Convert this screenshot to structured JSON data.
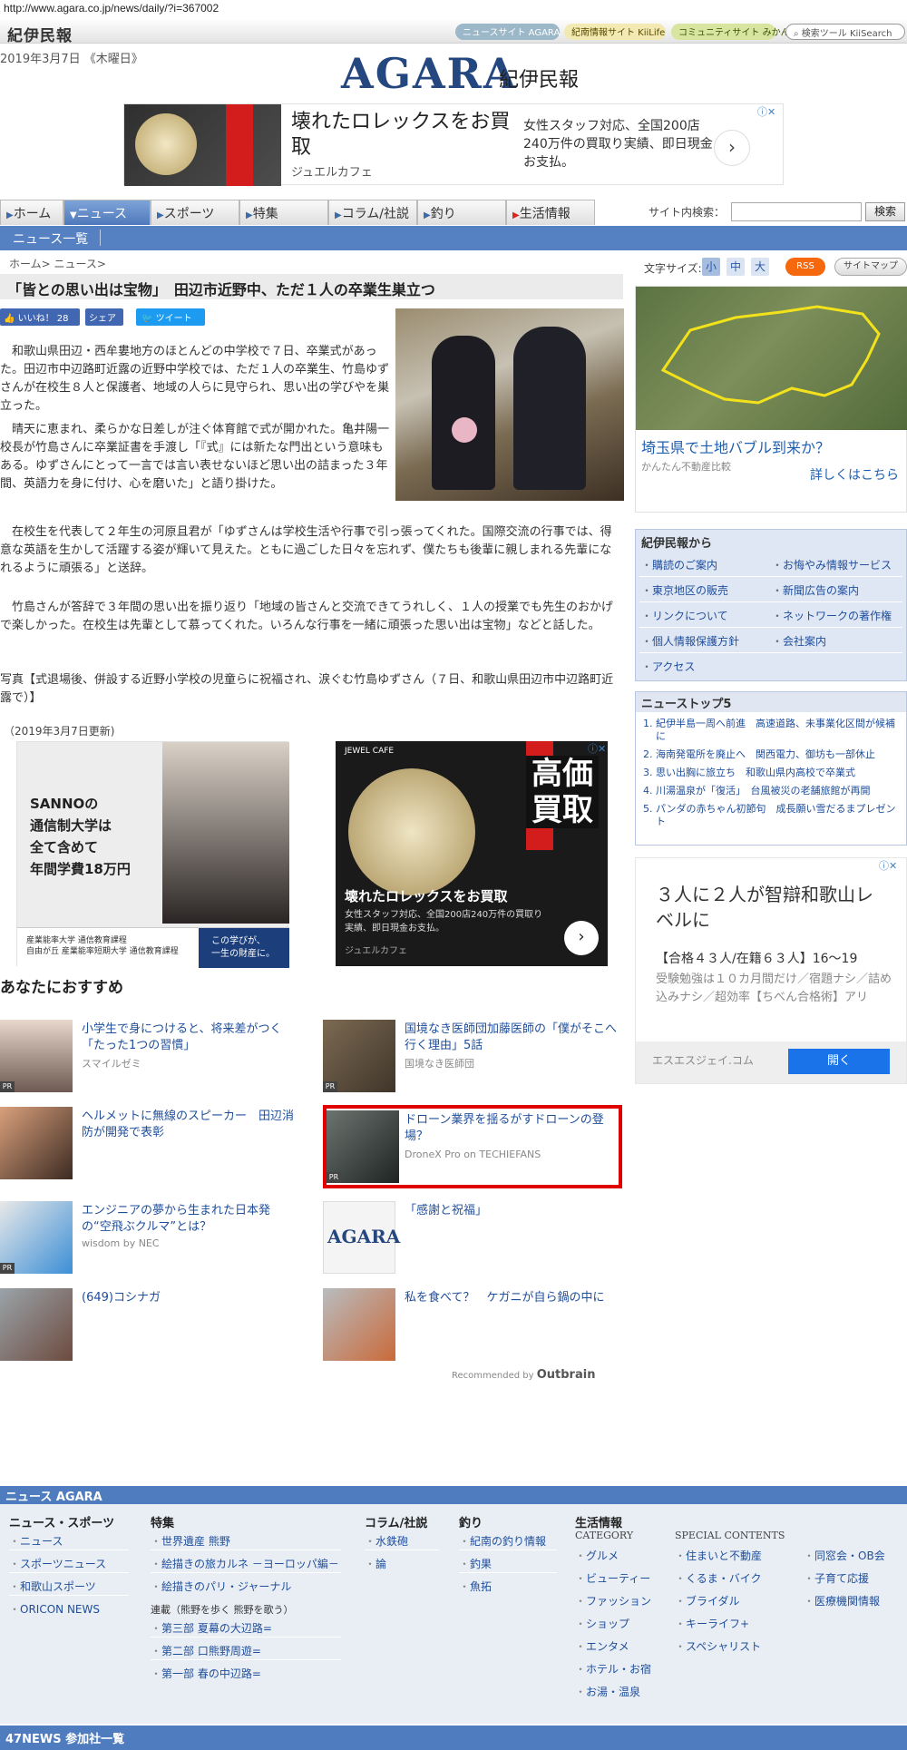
{
  "url": "http://www.agara.co.jp/news/daily/?i=367002",
  "site": {
    "small_logo": "紀伊民報",
    "top_links": [
      "ニュースサイト AGARA",
      "紀南情報サイト KiiLife",
      "コミュニティサイト みかん",
      "検索ツール KiiSearch"
    ],
    "date": "2019年3月7日 《木曜日》",
    "logo": "AGARA",
    "logo_sub": "紀伊民報"
  },
  "top_ad": {
    "headline": "壊れたロレックスをお買取",
    "advertiser": "ジュエルカフェ",
    "desc": "女性スタッフ対応、全国200店240万件の買取り実績、即日現金お支払。",
    "arrow": "›",
    "badge": "ⓘ✕"
  },
  "nav": {
    "tabs": [
      "ホーム",
      "ニュース",
      "スポーツ",
      "特集",
      "コラム/社説",
      "釣り",
      "生活情報"
    ],
    "search_label": "サイト内検索：",
    "search_button": "検索",
    "subnav": "ニュース一覧"
  },
  "article": {
    "breadcrumb": "ホーム> ニュース>",
    "title": "「皆との思い出は宝物」　田辺市近野中、ただ１人の卒業生巣立つ",
    "like": "👍 いいね！ 28",
    "share": "シェア",
    "tweet": "🐦 ツイート",
    "p1": "　和歌山県田辺・西牟婁地方のほとんどの中学校で７日、卒業式があった。田辺市中辺路町近露の近野中学校では、ただ１人の卒業生、竹島ゆずさんが在校生８人と保護者、地域の人らに見守られ、思い出の学びやを巣立った。",
    "p2": "　晴天に恵まれ、柔らかな日差しが注ぐ体育館で式が開かれた。亀井陽一校長が竹島さんに卒業証書を手渡し「『式』には新たな門出という意味もある。ゆずさんにとって一言では言い表せないほど思い出の詰まった３年間、英語力を身に付け、心を磨いた」と語り掛けた。",
    "p3": "　在校生を代表して２年生の河原且君が「ゆずさんは学校生活や行事で引っ張ってくれた。国際交流の行事では、得意な英語を生かして活躍する姿が輝いて見えた。ともに過ごした日々を忘れず、僕たちも後輩に親しまれる先輩になれるように頑張る」と送辞。",
    "p4": "　竹島さんが答辞で３年間の思い出を振り返り「地域の皆さんと交流できてうれしく、１人の授業でも先生のおかげで楽しかった。在校生は先輩として慕ってくれた。いろんな行事を一緒に頑張った思い出は宝物」などと話した。",
    "caption": "写真【式退場後、併設する近野小学校の児童らに祝福され、涙ぐむ竹島ゆずさん（７日、和歌山県田辺市中辺路町近露で）】",
    "updated": "（2019年3月7日更新)"
  },
  "mid_ads": {
    "left_text": "SANNOの\n通信制大学は\n全て含めて\n年間学費18万円",
    "left_foot1": "産業能率大学 通信教育課程\n自由が丘 産業能率短期大学 通信教育課程",
    "left_foot2": "この学びが、\n一生の財産に。",
    "right_head": "JEWEL CAFE",
    "right_big": "高価買取",
    "right_title": "壊れたロレックスをお買取",
    "right_sub": "女性スタッフ対応、全国200店240万件の買取り実績、即日現金お支払。",
    "right_src": "ジュエルカフェ"
  },
  "recommend": {
    "title": "あなたにおすすめ",
    "pr": "PR",
    "items": [
      {
        "title": "小学生で身につけると、将来差がつく「たった1つの習慣」",
        "source": "スマイルゼミ"
      },
      {
        "title": "国境なき医師団加藤医師の「僕がそこへ行く理由」5話",
        "source": "国境なき医師団"
      },
      {
        "title": "ヘルメットに無線のスピーカー　田辺消防が開発で表彰",
        "source": ""
      },
      {
        "title": "ドローン業界を揺るがすドローンの登場？",
        "source": "DroneX Pro on TECHIEFANS"
      },
      {
        "title": "エンジニアの夢から生まれた日本発の“空飛ぶクルマ”とは？",
        "source": "wisdom by NEC"
      },
      {
        "title": "「感謝と祝福」",
        "source": ""
      },
      {
        "title": "(649)コシナガ",
        "source": ""
      },
      {
        "title": "私を食べて？　ケガニが自ら鍋の中に",
        "source": ""
      }
    ],
    "thumb_logo": "AGARA",
    "outbrain": "Recommended by",
    "outbrain_brand": "Outbrain"
  },
  "sidebar": {
    "font_size_label": "文字サイズ:",
    "font_sizes": [
      "小",
      "中",
      "大"
    ],
    "rss": "RSS",
    "sitemap": "サイトマップ",
    "ad1_title": "埼玉県で土地バブル到来か？",
    "ad1_source": "かんたん不動産比較",
    "ad1_link": "詳しくはこちら",
    "kii_title": "紀伊民報から",
    "kii_links": [
      "購読のご案内",
      "お悔やみ情報サービス",
      "東京地区の販売",
      "新聞広告の案内",
      "リンクについて",
      "ネットワークの著作権",
      "個人情報保護方針",
      "会社案内",
      "アクセス"
    ],
    "top5_title": "ニューストップ5",
    "top5": [
      "紀伊半島一周へ前進　高速道路、未事業化区間が候補に",
      "海南発電所を廃止へ　関西電力、御坊も一部休止",
      "思い出胸に旅立ち　和歌山県内高校で卒業式",
      "川湯温泉が「復活」　台風被災の老舗旅館が再開",
      "パンダの赤ちゃん初節句　成長願い雪だるまプレゼント"
    ],
    "ad2_title": "３人に２人が智辯和歌山レベルに",
    "ad2_sub": "【合格４３人/在籍６３人】16〜19",
    "ad2_desc": "受験勉強は１０カ月間だけ／宿題ナシ／詰め込みナシ／超効率【ちべん合格術】アリ",
    "ad2_name": "エスエスジェイ.コム",
    "ad2_button": "開く"
  },
  "footer": {
    "bar": "ニュース AGARA",
    "col1_head": "ニュース・スポーツ",
    "col1": [
      "ニュース",
      "スポーツニュース",
      "和歌山スポーツ",
      "ORICON NEWS"
    ],
    "col2_head": "特集",
    "col2": [
      "世界遺産 熊野",
      "絵描きの旅カルネ －ヨーロッパ編－",
      "絵描きのパリ・ジャーナル"
    ],
    "col2_sub": "連載（熊野を歩く 熊野を歌う）",
    "col2b": [
      "第三部 夏幕の大辺路=",
      "第二部 口熊野周遊=",
      "第一部 春の中辺路="
    ],
    "col3_head": "コラム/社説",
    "col3": [
      "水鉄砲",
      "論"
    ],
    "col4_head": "釣り",
    "col4": [
      "紀南の釣り情報",
      "釣果",
      "魚拓"
    ],
    "col5_head": "生活情報",
    "cat_label": "CATEGORY",
    "special_label": "SPECIAL CONTENTS",
    "cat": [
      "グルメ",
      "ビューティー",
      "ファッション",
      "ショップ",
      "エンタメ",
      "ホテル・お宿",
      "お湯・温泉"
    ],
    "sp1": [
      "住まいと不動産",
      "くるま・バイク",
      "ブライダル",
      "キーライフ+",
      "スペシャリスト"
    ],
    "sp2": [
      "同窓会・OB会",
      "子育て応援",
      "医療機関情報"
    ],
    "bar2": "47NEWS 参加社一覧"
  }
}
